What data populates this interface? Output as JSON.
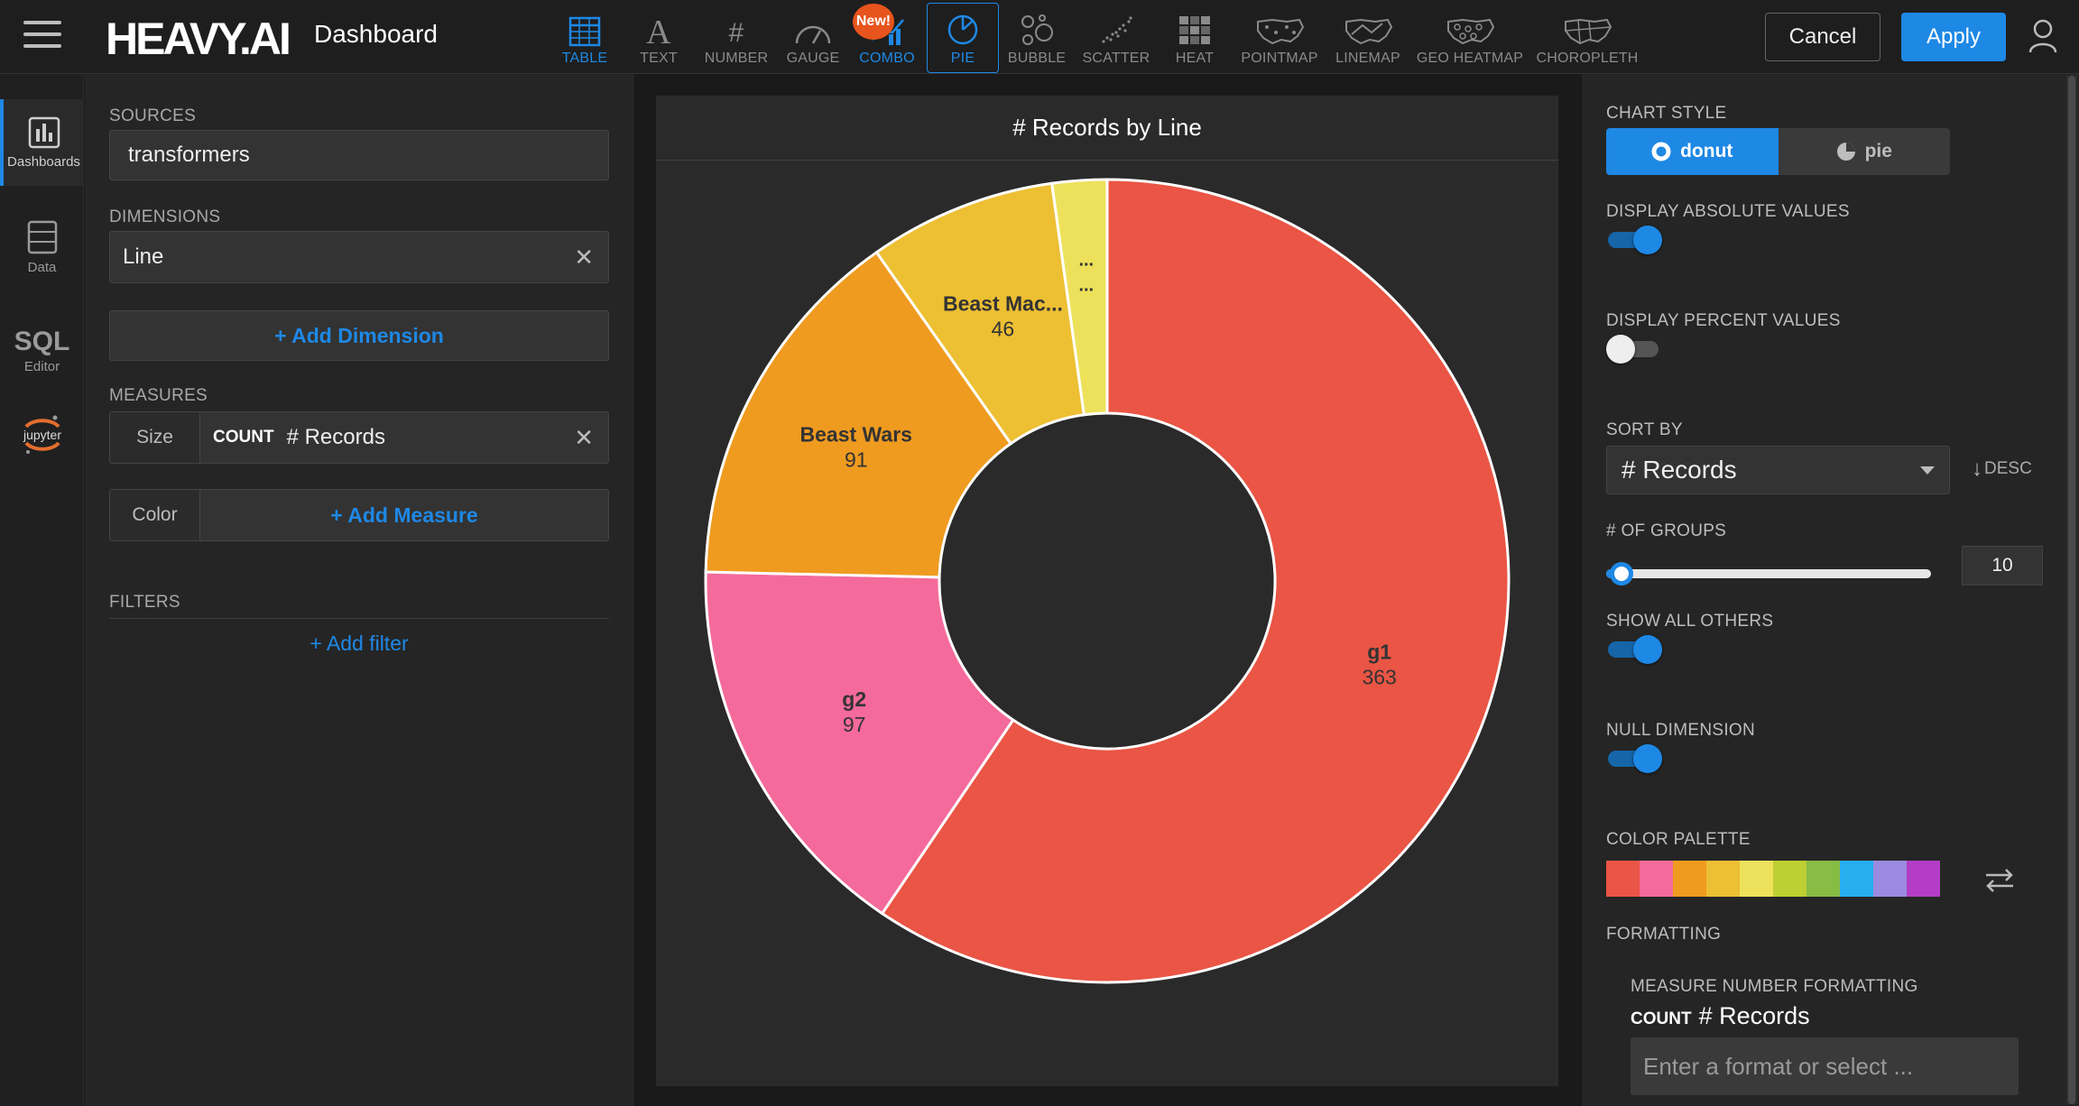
{
  "header": {
    "logo": "HEAVY.AI",
    "title": "Dashboard",
    "new_badge": "New!",
    "cancel_label": "Cancel",
    "apply_label": "Apply",
    "chart_types": [
      {
        "label": "TABLE",
        "icon": "table-icon"
      },
      {
        "label": "TEXT",
        "icon": "text-icon"
      },
      {
        "label": "NUMBER",
        "icon": "number-icon"
      },
      {
        "label": "GAUGE",
        "icon": "gauge-icon"
      },
      {
        "label": "COMBO",
        "icon": "combo-icon"
      },
      {
        "label": "PIE",
        "icon": "pie-icon"
      },
      {
        "label": "BUBBLE",
        "icon": "bubble-icon"
      },
      {
        "label": "SCATTER",
        "icon": "scatter-icon"
      },
      {
        "label": "HEAT",
        "icon": "heat-icon"
      },
      {
        "label": "POINTMAP",
        "icon": "pointmap-icon"
      },
      {
        "label": "LINEMAP",
        "icon": "linemap-icon"
      },
      {
        "label": "GEO HEATMAP",
        "icon": "geo-heatmap-icon"
      },
      {
        "label": "CHOROPLETH",
        "icon": "choropleth-icon"
      }
    ],
    "selected_chart_type": "PIE"
  },
  "leftnav": {
    "items": [
      {
        "label": "Dashboards",
        "icon": "dashboards-icon"
      },
      {
        "label": "Data",
        "icon": "data-icon"
      },
      {
        "label": "Editor",
        "icon_text": "SQL"
      },
      {
        "label": "jupyter",
        "icon": "jupyter-icon"
      }
    ]
  },
  "config": {
    "sources_label": "SOURCES",
    "source_value": "transformers",
    "dimensions_label": "DIMENSIONS",
    "dimension_value": "Line",
    "add_dimension": "+ Add Dimension",
    "measures_label": "MEASURES",
    "size_label": "Size",
    "size_agg": "COUNT",
    "size_value": "# Records",
    "color_label": "Color",
    "add_measure": "+ Add Measure",
    "filters_label": "FILTERS",
    "add_filter": "+ Add filter"
  },
  "chart_data": {
    "type": "pie",
    "style": "donut",
    "title": "# Records by Line",
    "categories": [
      "g1",
      "g2",
      "Beast Wars",
      "Beast Mac...",
      "..."
    ],
    "values": [
      363,
      97,
      91,
      46,
      null
    ],
    "colors": [
      "#ea5545",
      "#f46a9b",
      "#ef9b20",
      "#edbf33",
      "#ede15b"
    ],
    "small_slice_label": "..."
  },
  "settings": {
    "chart_style_label": "CHART STYLE",
    "style_options": [
      "donut",
      "pie"
    ],
    "style_selected": "donut",
    "abs_values_label": "DISPLAY ABSOLUTE VALUES",
    "abs_values_on": true,
    "pct_values_label": "DISPLAY PERCENT VALUES",
    "pct_values_on": false,
    "sort_by_label": "SORT BY",
    "sort_by_value": "# Records",
    "sort_dir": "DESC",
    "groups_label": "# OF GROUPS",
    "groups_value": "10",
    "groups_slider_fraction": 0.03,
    "show_all_others_label": "SHOW ALL OTHERS",
    "show_all_others_on": true,
    "null_dimension_label": "NULL DIMENSION",
    "null_dimension_on": true,
    "color_palette_label": "COLOR PALETTE",
    "palette": [
      "#ea5545",
      "#f46a9b",
      "#ef9b20",
      "#edbf33",
      "#ede15b",
      "#bdcf32",
      "#87bc45",
      "#27aeef",
      "#9b8be0",
      "#b33dc6"
    ],
    "formatting_label": "FORMATTING",
    "measure_number_formatting_label": "MEASURE NUMBER FORMATTING",
    "fmt_agg": "COUNT",
    "fmt_measure": "# Records",
    "fmt_placeholder": "Enter a format or select ..."
  }
}
